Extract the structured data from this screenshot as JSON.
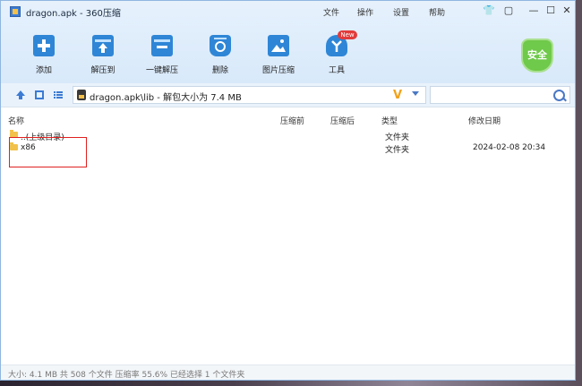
{
  "window": {
    "title": "dragon.apk - 360压缩",
    "menu": [
      "文件",
      "操作",
      "设置",
      "帮助"
    ]
  },
  "toolbar": {
    "buttons": [
      {
        "label": "添加",
        "icon": "add-icon",
        "color": "#2f86d6"
      },
      {
        "label": "解压到",
        "icon": "extract-to-icon",
        "color": "#2f86d6"
      },
      {
        "label": "一键解压",
        "icon": "one-click-extract-icon",
        "color": "#2f86d6"
      },
      {
        "label": "删除",
        "icon": "recycle-icon",
        "color": "#2f86d6"
      },
      {
        "label": "图片压缩",
        "icon": "image-compress-icon",
        "color": "#2f86d6"
      },
      {
        "label": "工具",
        "icon": "tools-icon",
        "color": "#2f86d6"
      }
    ],
    "new_badge": "New",
    "safety_label": "安全",
    "safety_color": "#6fc94a"
  },
  "address": {
    "path": "dragon.apk\\lib - 解包大小为 7.4 MB"
  },
  "columns": {
    "name": "名称",
    "compressed": "压缩前",
    "after": "压缩后",
    "type": "类型",
    "modified": "修改日期"
  },
  "rows": [
    {
      "name": "..(上级目录)",
      "type": "文件夹",
      "modified": ""
    },
    {
      "name": "x86",
      "type": "文件夹",
      "modified": "2024-02-08 20:34"
    }
  ],
  "status": {
    "text": "大小: 4.1 MB 共 508 个文件 压缩率 55.6% 已经选择 1 个文件夹"
  },
  "colors": {
    "accent": "#2f86d6",
    "highlight_box": "#e02020"
  }
}
